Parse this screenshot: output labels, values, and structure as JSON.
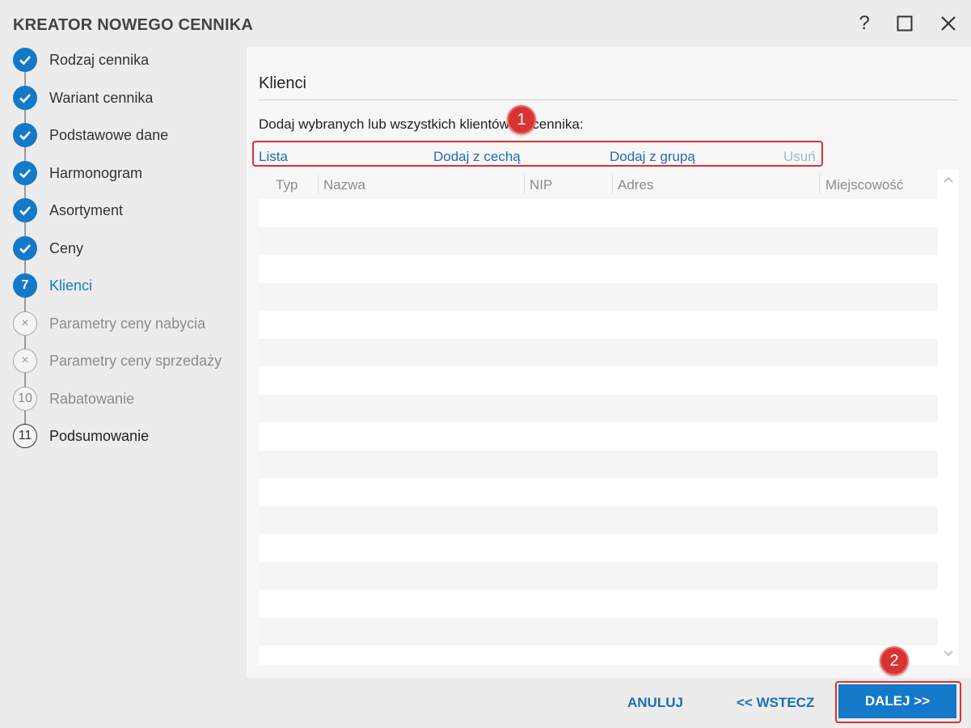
{
  "window": {
    "title": "KREATOR NOWEGO CENNIKA",
    "help_label": "?"
  },
  "steps": [
    {
      "label": "Rodzaj cennika",
      "state": "done",
      "marker": ""
    },
    {
      "label": "Wariant cennika",
      "state": "done",
      "marker": ""
    },
    {
      "label": "Podstawowe dane",
      "state": "done",
      "marker": ""
    },
    {
      "label": "Harmonogram",
      "state": "done",
      "marker": ""
    },
    {
      "label": "Asortyment",
      "state": "done",
      "marker": ""
    },
    {
      "label": "Ceny",
      "state": "done",
      "marker": ""
    },
    {
      "label": "Klienci",
      "state": "active",
      "marker": "7"
    },
    {
      "label": "Parametry ceny nabycia",
      "state": "skipped",
      "marker": "×"
    },
    {
      "label": "Parametry ceny sprzedaży",
      "state": "skipped",
      "marker": "×"
    },
    {
      "label": "Rabatowanie",
      "state": "pending-grey",
      "marker": "10"
    },
    {
      "label": "Podsumowanie",
      "state": "pending",
      "marker": "11"
    }
  ],
  "main": {
    "section_title": "Klienci",
    "description": "Dodaj wybranych lub wszystkich klientów do cennika:",
    "actions": {
      "list": "Lista",
      "add_by_feature": "Dodaj z cechą",
      "add_by_group": "Dodaj z grupą",
      "remove": "Usuń"
    },
    "grid": {
      "columns": [
        "Typ",
        "Nazwa",
        "NIP",
        "Adres",
        "Miejscowość"
      ],
      "rows": []
    }
  },
  "annotations": {
    "marker_1": "1",
    "marker_2": "2"
  },
  "footer": {
    "cancel": "ANULUJ",
    "back": "<< WSTECZ",
    "next": "DALEJ >>"
  },
  "colors": {
    "accent": "#1479c9",
    "link": "#1c6fb4",
    "highlight": "#e03030"
  }
}
